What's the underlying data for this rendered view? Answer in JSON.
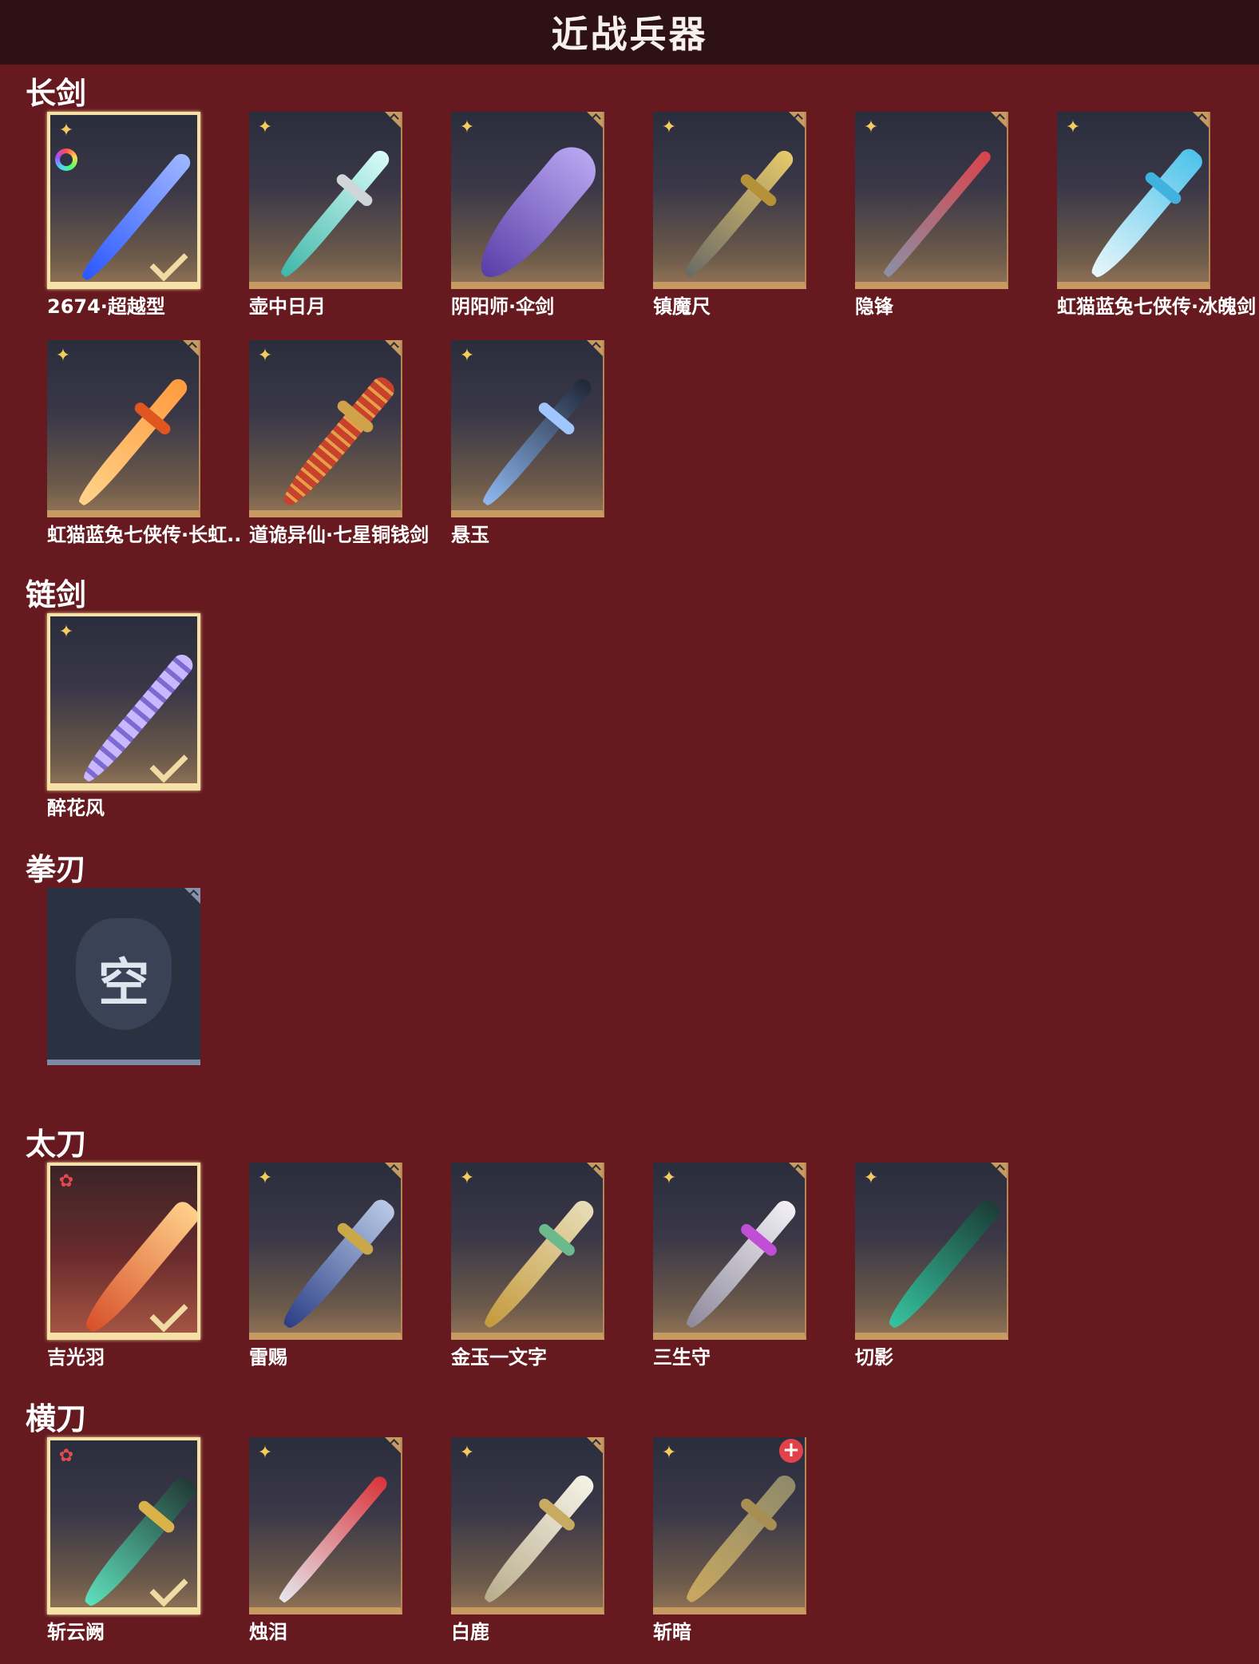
{
  "header": {
    "title": "近战兵器"
  },
  "sections": {
    "changjian": {
      "title": "长剑",
      "items": [
        {
          "name": "2674·超越型",
          "equipped": true,
          "color": "#3d6cff"
        },
        {
          "name": "壶中日月",
          "color": "#5fd4c7"
        },
        {
          "name": "阴阳师·伞剑",
          "color": "#7a5cc9"
        },
        {
          "name": "镇魔尺",
          "color": "#c7a94d"
        },
        {
          "name": "隐锋",
          "color": "#c23b3b"
        },
        {
          "name": "虹猫蓝兔七侠传·冰魄剑",
          "color": "#5fc4e6"
        },
        {
          "name": "虹猫蓝兔七侠传·长虹..",
          "color": "#f07a2e"
        },
        {
          "name": "道诡异仙·七星铜钱剑",
          "color": "#c3452d"
        },
        {
          "name": "悬玉",
          "color": "#4a7fd6"
        }
      ]
    },
    "lianjian": {
      "title": "链剑",
      "items": [
        {
          "name": "醉花风",
          "equipped": true,
          "color": "#a88af0"
        }
      ]
    },
    "quanren": {
      "title": "拳刃",
      "items": [
        {
          "name": "",
          "empty": true,
          "empty_text": "空"
        }
      ]
    },
    "taidao": {
      "title": "太刀",
      "items": [
        {
          "name": "吉光羽",
          "equipped": true,
          "color": "#e0683a"
        },
        {
          "name": "雷赐",
          "color": "#3a5fb0"
        },
        {
          "name": "金玉一文字",
          "color": "#d9b65a"
        },
        {
          "name": "三生守",
          "color": "#d8d6e0"
        },
        {
          "name": "切影",
          "color": "#2aa58a"
        }
      ]
    },
    "hengdao": {
      "title": "横刀",
      "items": [
        {
          "name": "斩云阙",
          "equipped": true,
          "color": "#3dbb9c"
        },
        {
          "name": "烛泪",
          "color": "#d83a34"
        },
        {
          "name": "白鹿",
          "color": "#e8e2d0"
        },
        {
          "name": "斩暗",
          "color": "#b09555"
        }
      ]
    }
  },
  "icons": {
    "rarity": "four-point-star-icon",
    "rarity_red": "red-flower-icon",
    "equipped": "check-icon",
    "new": "new-plus-icon",
    "color_ring": "color-ring-icon"
  }
}
